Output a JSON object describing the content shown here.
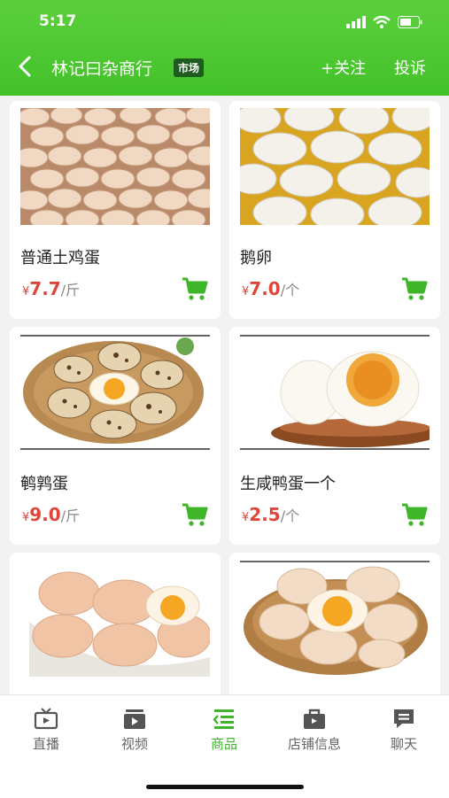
{
  "status_bar": {
    "time": "5:17"
  },
  "header": {
    "shop_name": "林记曰杂商行",
    "badge": "市场",
    "follow_label": "+关注",
    "report_label": "投诉"
  },
  "products": [
    {
      "name": "普通土鸡蛋",
      "currency": "¥",
      "price": "7.7",
      "unit": "/斤"
    },
    {
      "name": "鹅卵",
      "currency": "¥",
      "price": "7.0",
      "unit": "/个"
    },
    {
      "name": "鹌鹑蛋",
      "currency": "¥",
      "price": "9.0",
      "unit": "/斤"
    },
    {
      "name": "生咸鸭蛋一个",
      "currency": "¥",
      "price": "2.5",
      "unit": "/个"
    }
  ],
  "tabs": [
    {
      "label": "直播",
      "icon": "tv-icon"
    },
    {
      "label": "视频",
      "icon": "video-icon"
    },
    {
      "label": "商品",
      "icon": "list-icon",
      "active": true
    },
    {
      "label": "店铺信息",
      "icon": "store-icon"
    },
    {
      "label": "聊天",
      "icon": "chat-icon"
    }
  ],
  "colors": {
    "brand_green": "#43c22a",
    "price_red": "#e0453a",
    "badge_bg": "#1f5a1f"
  }
}
